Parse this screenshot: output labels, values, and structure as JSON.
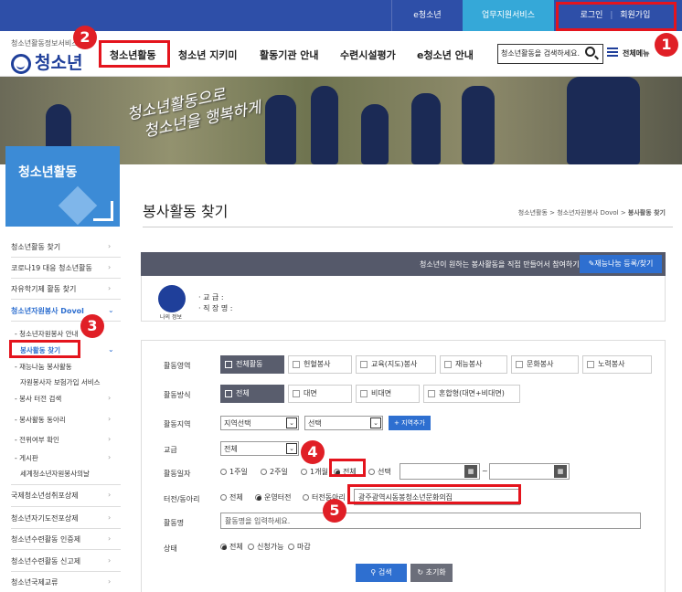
{
  "topbar": {
    "eyouth": "e청소년",
    "biz": "업무지원서비스",
    "login": "로그인",
    "sep": "|",
    "join": "회원가입"
  },
  "header": {
    "logo_sub": "청소년활동정보서비스",
    "logo": "청소년",
    "nav": [
      "청소년활동",
      "청소년 지키미",
      "활동기관 안내",
      "수련시설평가",
      "e청소년 안내"
    ],
    "search_value": "청소년활동을 검색하세요.",
    "all_menu": "전체메뉴"
  },
  "banner": {
    "text_line1": "청소년활동으로",
    "text_line2": "청소년을 행복하게"
  },
  "sidebar": {
    "title": "청소년활동",
    "items": [
      "청소년활동 찾기",
      "코로나19 대응 청소년활동",
      "자유학기제 활동 찾기",
      "청소년자원봉사 Dovol"
    ],
    "sub": [
      "- 청소년자원봉사 안내",
      "봉사활동 찾기",
      "- 재능나눔 봉사활동",
      "자원봉사자 보험가입 서비스",
      "- 봉사 터전 검색",
      "- 봉사활동 동아리",
      "- 전위여부 확인",
      "- 게시판",
      "세계청소년자원봉사의날"
    ],
    "bottom": [
      "국제청소년성취포상제",
      "청소년자기도전포상제",
      "청소년수련활동 인증제",
      "청소년수련활동 신고제",
      "청소년국제교류"
    ]
  },
  "main": {
    "title": "봉사활동 찾기",
    "breadcrumb_pre": "청소년활동 > 청소년자원봉사 Dovol > ",
    "breadcrumb_current": "봉사활동 찾기"
  },
  "bar": {
    "text": "청소년이 원하는 봉사활동을 직접 만들어서 참여하기",
    "button": "재능나눔 등록/찾기"
  },
  "profile": {
    "caption": "나의 정보",
    "school_label": "· 교       급    :",
    "center_label": "· 직 장 명    :"
  },
  "form": {
    "labels": {
      "area": "활동영역",
      "method": "활동방식",
      "region": "활동지역",
      "grade": "교급",
      "date": "활동일자",
      "center": "터전/동아리",
      "name": "활동명",
      "status": "상태"
    },
    "area": [
      "전체활동",
      "헌혈봉사",
      "교육(지도)봉사",
      "재능봉사",
      "문화봉사",
      "노력봉사"
    ],
    "method": [
      "전체",
      "대면",
      "비대면",
      "혼합형(대면+비대면)"
    ],
    "region_select": "지역선택",
    "region_select2": "선택",
    "region_add": "지역추가",
    "grade_select": "전체",
    "date_opts": [
      "1주일",
      "2주일",
      "1개월",
      "전체",
      "선택"
    ],
    "date_sep": "~",
    "center_opts": [
      "전체",
      "운영터전",
      "터전동아리"
    ],
    "center_value": "광주광역시동봉청소년문화의집",
    "name_placeholder": "활동명을 입력하세요.",
    "status_opts": [
      "전체",
      "신청가능",
      "마감"
    ],
    "search_btn": "검색",
    "reset_btn": "초기화"
  },
  "annotations": [
    "1",
    "2",
    "3",
    "4",
    "5"
  ]
}
